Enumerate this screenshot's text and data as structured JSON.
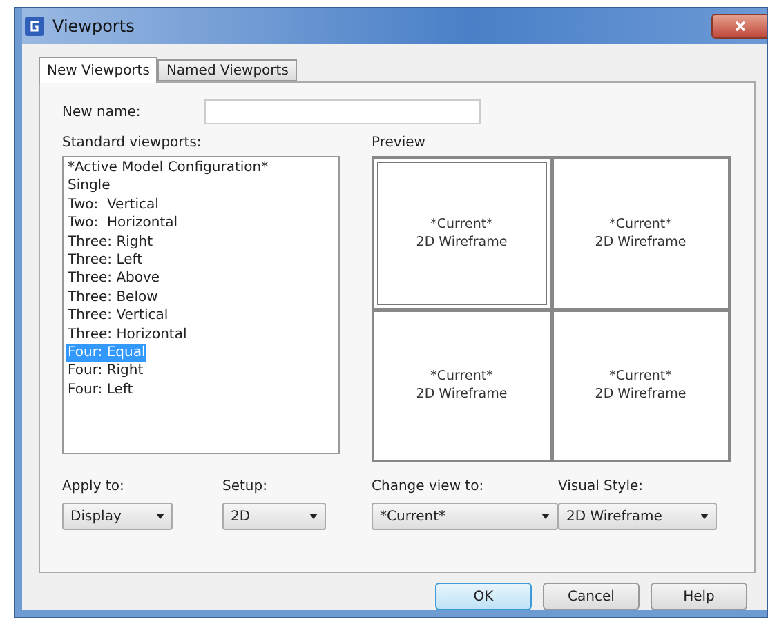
{
  "window": {
    "title": "Viewports"
  },
  "tabs": [
    {
      "label": "New Viewports",
      "selected": true
    },
    {
      "label": "Named Viewports",
      "selected": false
    }
  ],
  "new_name": {
    "label": "New name:"
  },
  "standard_viewports": {
    "label": "Standard viewports:",
    "items": [
      {
        "label": "*Active Model Configuration*",
        "selected": false
      },
      {
        "label": "Single",
        "selected": false
      },
      {
        "label": "Two:  Vertical",
        "selected": false
      },
      {
        "label": "Two:  Horizontal",
        "selected": false
      },
      {
        "label": "Three: Right",
        "selected": false
      },
      {
        "label": "Three: Left",
        "selected": false
      },
      {
        "label": "Three: Above",
        "selected": false
      },
      {
        "label": "Three: Below",
        "selected": false
      },
      {
        "label": "Three: Vertical",
        "selected": false
      },
      {
        "label": "Three: Horizontal",
        "selected": false
      },
      {
        "label": "Four: Equal",
        "selected": true
      },
      {
        "label": "Four: Right",
        "selected": false
      },
      {
        "label": "Four: Left",
        "selected": false
      }
    ]
  },
  "preview": {
    "label": "Preview",
    "viewports": [
      {
        "view": "*Current*",
        "style": "2D Wireframe",
        "selected": true
      },
      {
        "view": "*Current*",
        "style": "2D Wireframe",
        "selected": false
      },
      {
        "view": "*Current*",
        "style": "2D Wireframe",
        "selected": false
      },
      {
        "view": "*Current*",
        "style": "2D Wireframe",
        "selected": false
      }
    ]
  },
  "dropdowns": [
    {
      "label": "Apply to:",
      "value": "Display"
    },
    {
      "label": "Setup:",
      "value": "2D"
    },
    {
      "label": "Change view to:",
      "value": "*Current*"
    },
    {
      "label": "Visual Style:",
      "value": "2D Wireframe"
    }
  ],
  "buttons": [
    {
      "label": "OK",
      "default": true
    },
    {
      "label": "Cancel",
      "default": false
    },
    {
      "label": "Help",
      "default": false
    }
  ]
}
